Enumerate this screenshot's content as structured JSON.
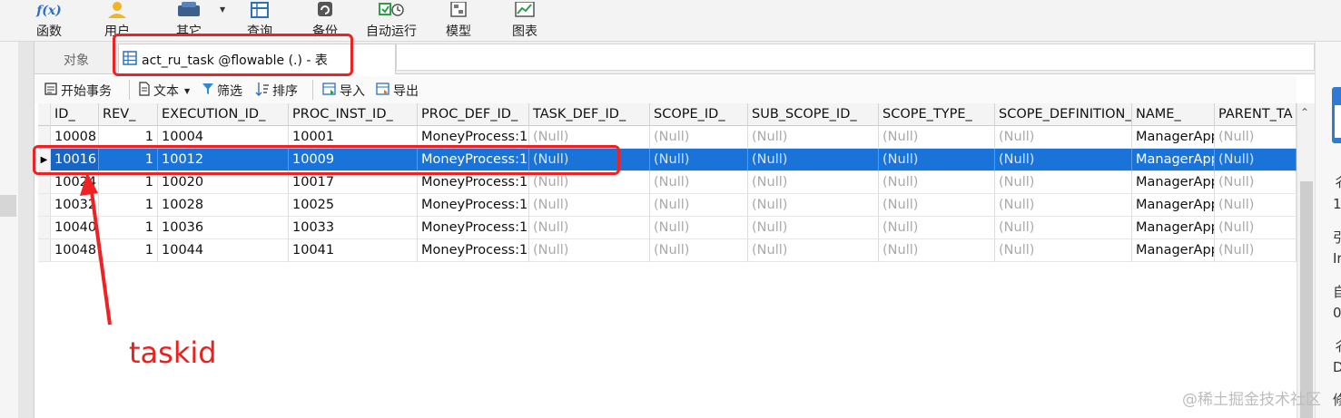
{
  "ribbon": {
    "items": [
      {
        "label": "函数",
        "icon": "function-icon"
      },
      {
        "label": "用户",
        "icon": "user-icon"
      },
      {
        "label": "其它",
        "icon": "other-tools-icon"
      },
      {
        "label": "查询",
        "icon": "query-icon"
      },
      {
        "label": "备份",
        "icon": "backup-icon"
      },
      {
        "label": "自动运行",
        "icon": "scheduler-icon"
      },
      {
        "label": "模型",
        "icon": "model-icon"
      },
      {
        "label": "图表",
        "icon": "chart-icon"
      }
    ]
  },
  "tabs": {
    "objects": "对象",
    "active": "act_ru_task @flowable (.) - 表"
  },
  "toolbar": {
    "begin_transaction": "开始事务",
    "text": "文本",
    "filter": "筛选",
    "sort": "排序",
    "import": "导入",
    "export": "导出"
  },
  "grid": {
    "columns": [
      "ID_",
      "REV_",
      "EXECUTION_ID_",
      "PROC_INST_ID_",
      "PROC_DEF_ID_",
      "TASK_DEF_ID_",
      "SCOPE_ID_",
      "SUB_SCOPE_ID_",
      "SCOPE_TYPE_",
      "SCOPE_DEFINITION_",
      "NAME_",
      "PARENT_TA"
    ],
    "rows": [
      [
        "10008",
        "1",
        "10004",
        "10001",
        "MoneyProcess:1",
        "(Null)",
        "(Null)",
        "(Null)",
        "(Null)",
        "(Null)",
        "ManagerApp",
        "(Null)"
      ],
      [
        "10016",
        "1",
        "10012",
        "10009",
        "MoneyProcess:1",
        "(Null)",
        "(Null)",
        "(Null)",
        "(Null)",
        "(Null)",
        "ManagerApp",
        "(Null)"
      ],
      [
        "10024",
        "1",
        "10020",
        "10017",
        "MoneyProcess:1",
        "(Null)",
        "(Null)",
        "(Null)",
        "(Null)",
        "(Null)",
        "ManagerApp",
        "(Null)"
      ],
      [
        "10032",
        "1",
        "10028",
        "10025",
        "MoneyProcess:1",
        "(Null)",
        "(Null)",
        "(Null)",
        "(Null)",
        "(Null)",
        "ManagerApp",
        "(Null)"
      ],
      [
        "10040",
        "1",
        "10036",
        "10033",
        "MoneyProcess:1",
        "(Null)",
        "(Null)",
        "(Null)",
        "(Null)",
        "(Null)",
        "ManagerApp",
        "(Null)"
      ],
      [
        "10048",
        "1",
        "10044",
        "10041",
        "MoneyProcess:1",
        "(Null)",
        "(Null)",
        "(Null)",
        "(Null)",
        "(Null)",
        "ManagerApp",
        "(Null)"
      ]
    ],
    "selected_row": 1
  },
  "right_panel": [
    "彳",
    "1",
    "引",
    "Ir",
    "自",
    "0",
    "彳",
    "D",
    "修"
  ],
  "annotation": {
    "label": "taskid",
    "color": "#e8211e"
  },
  "watermark": "@稀土掘金技术社区",
  "colors": {
    "selection": "#1a73d8",
    "highlight": "#ee2222",
    "accent": "#2f7ad6"
  }
}
